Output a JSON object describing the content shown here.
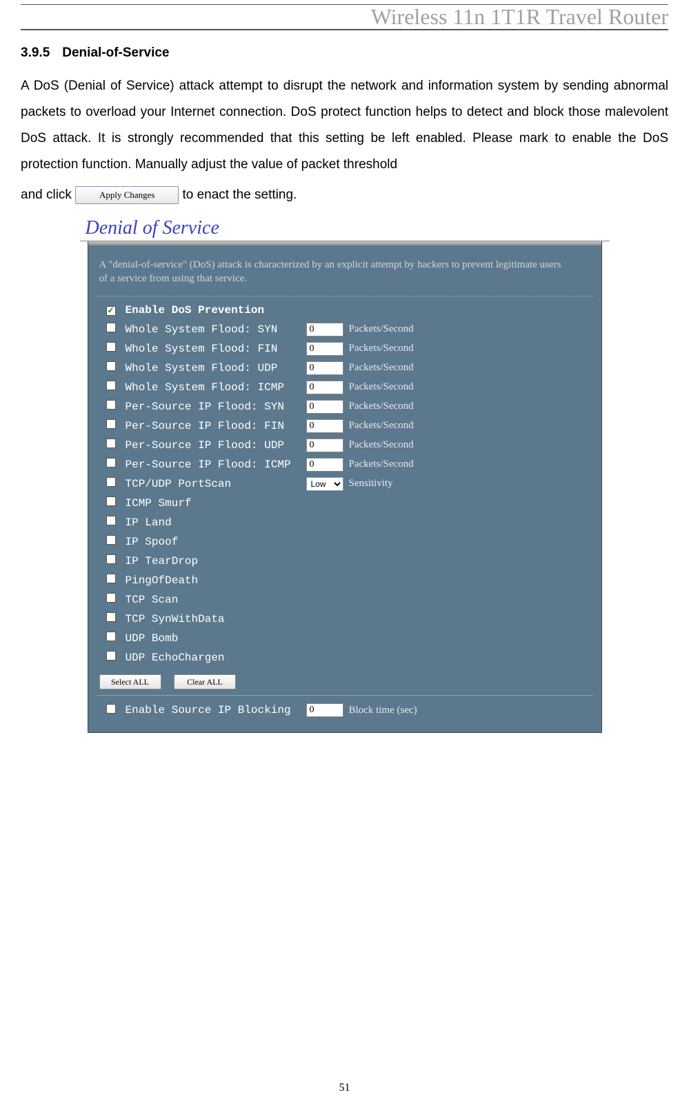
{
  "header": {
    "title": "Wireless 11n 1T1R Travel Router"
  },
  "section": {
    "number": "3.9.5",
    "title": "Denial-of-Service",
    "body_part1": "A DoS (Denial of Service) attack attempt to disrupt the network and information system by sending abnormal packets to overload your Internet connection. DoS protect function helps to detect and block those malevolent DoS attack. It is strongly recommended that this setting be left enabled. Please mark to enable the DoS protection function. Manually adjust the value of packet threshold",
    "body_part2a": "and click",
    "apply_button": "Apply Changes",
    "body_part2b": "to enact the setting."
  },
  "panel": {
    "title": "Denial of Service",
    "desc": "A \"denial-of-service\" (DoS) attack is characterized by an explicit attempt by hackers to prevent legitimate users of a service from using that service.",
    "enable_label": "Enable DoS Prevention",
    "enable_checked": true,
    "rows": [
      {
        "label": "Whole System Flood: SYN",
        "value": "0",
        "unit": "Packets/Second",
        "type": "input"
      },
      {
        "label": "Whole System Flood: FIN",
        "value": "0",
        "unit": "Packets/Second",
        "type": "input"
      },
      {
        "label": "Whole System Flood: UDP",
        "value": "0",
        "unit": "Packets/Second",
        "type": "input"
      },
      {
        "label": "Whole System Flood: ICMP",
        "value": "0",
        "unit": "Packets/Second",
        "type": "input"
      },
      {
        "label": "Per-Source IP Flood: SYN",
        "value": "0",
        "unit": "Packets/Second",
        "type": "input"
      },
      {
        "label": "Per-Source IP Flood: FIN",
        "value": "0",
        "unit": "Packets/Second",
        "type": "input"
      },
      {
        "label": "Per-Source IP Flood: UDP",
        "value": "0",
        "unit": "Packets/Second",
        "type": "input"
      },
      {
        "label": "Per-Source IP Flood: ICMP",
        "value": "0",
        "unit": "Packets/Second",
        "type": "input"
      },
      {
        "label": "TCP/UDP PortScan",
        "value": "Low",
        "unit": "Sensitivity",
        "type": "select"
      },
      {
        "label": "ICMP Smurf",
        "type": "none"
      },
      {
        "label": "IP Land",
        "type": "none"
      },
      {
        "label": "IP Spoof",
        "type": "none"
      },
      {
        "label": "IP TearDrop",
        "type": "none"
      },
      {
        "label": "PingOfDeath",
        "type": "none"
      },
      {
        "label": "TCP Scan",
        "type": "none"
      },
      {
        "label": "TCP SynWithData",
        "type": "none"
      },
      {
        "label": "UDP Bomb",
        "type": "none"
      },
      {
        "label": "UDP EchoChargen",
        "type": "none"
      }
    ],
    "buttons": {
      "select_all": "Select ALL",
      "clear_all": "Clear ALL"
    },
    "source_block": {
      "label": "Enable Source IP Blocking",
      "value": "0",
      "unit": "Block time (sec)"
    }
  },
  "page_number": "51"
}
